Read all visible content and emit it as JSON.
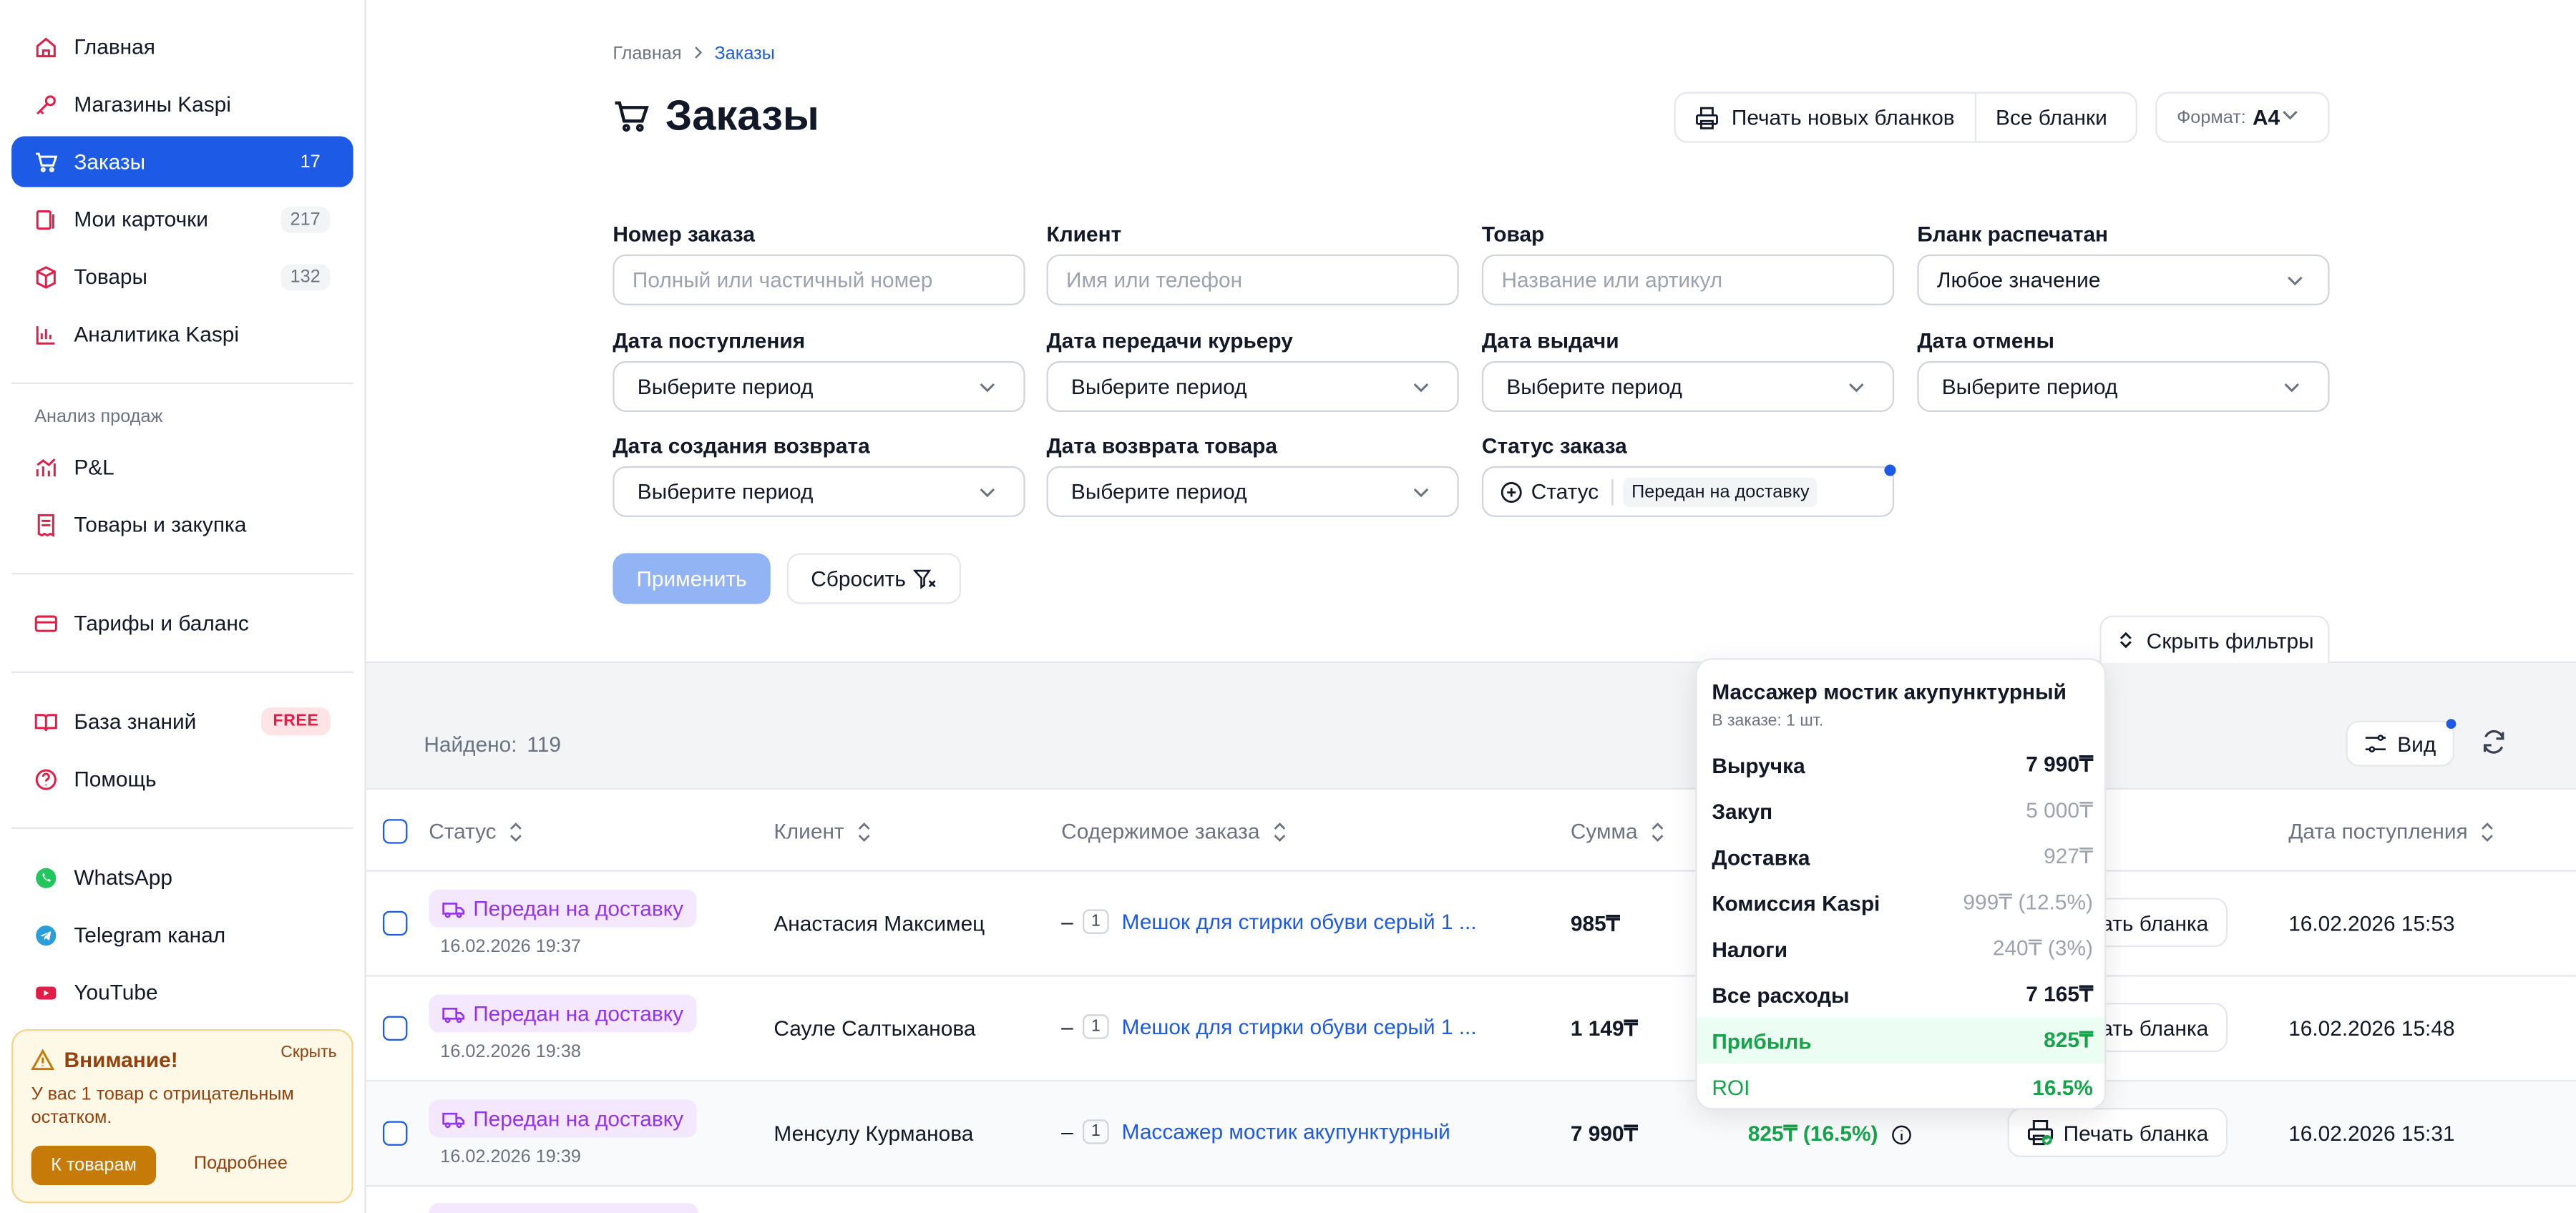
{
  "sidebar": {
    "items": [
      {
        "label": "Главная"
      },
      {
        "label": "Магазины Kaspi"
      },
      {
        "label": "Заказы",
        "count": "17"
      },
      {
        "label": "Мои карточки",
        "count": "217"
      },
      {
        "label": "Товары",
        "count": "132"
      },
      {
        "label": "Аналитика Kaspi"
      }
    ],
    "section_label": "Анализ продаж",
    "analysis_items": [
      {
        "label": "P&L"
      },
      {
        "label": "Товары и закупка"
      }
    ],
    "billing_label": "Тарифы и баланс",
    "knowledge_label": "База знаний",
    "knowledge_badge": "FREE",
    "help_label": "Помощь",
    "social": [
      {
        "label": "WhatsApp"
      },
      {
        "label": "Telegram канал"
      },
      {
        "label": "YouTube"
      }
    ],
    "warning": {
      "title": "Внимание!",
      "hide": "Скрыть",
      "text": "У вас 1 товар с отрицательным остатком.",
      "button": "К товарам",
      "more": "Подробнее"
    }
  },
  "breadcrumb": {
    "home": "Главная",
    "current": "Заказы"
  },
  "page_title": "Заказы",
  "toolbar": {
    "print_new": "Печать новых бланков",
    "all_forms": "Все бланки",
    "format_label": "Формат:",
    "format_value": "A4"
  },
  "filters": {
    "order_number": {
      "label": "Номер заказа",
      "placeholder": "Полный или частичный номер"
    },
    "client": {
      "label": "Клиент",
      "placeholder": "Имя или телефон"
    },
    "product": {
      "label": "Товар",
      "placeholder": "Название или артикул"
    },
    "form_printed": {
      "label": "Бланк распечатан",
      "value": "Любое значение"
    },
    "date_received": {
      "label": "Дата поступления",
      "value": "Выберите период"
    },
    "date_courier": {
      "label": "Дата передачи курьеру",
      "value": "Выберите период"
    },
    "date_issue": {
      "label": "Дата выдачи",
      "value": "Выберите период"
    },
    "date_cancel": {
      "label": "Дата отмены",
      "value": "Выберите период"
    },
    "date_return_created": {
      "label": "Дата создания возврата",
      "value": "Выберите период"
    },
    "date_return_product": {
      "label": "Дата возврата товара",
      "value": "Выберите период"
    },
    "order_status": {
      "label": "Статус заказа",
      "button": "Статус",
      "chip": "Передан на доставку"
    },
    "apply": "Применить",
    "reset": "Сбросить",
    "hide_filters": "Скрыть фильтры"
  },
  "results": {
    "found_label": "Найдено:",
    "found_count": "119",
    "view_label": "Вид"
  },
  "table": {
    "headers": {
      "status": "Статус",
      "client": "Клиент",
      "content": "Содержимое заказа",
      "sum": "Сумма",
      "date": "Дата поступления"
    },
    "rows": [
      {
        "status": "Передан на доставку",
        "status_date": "16.02.2026 19:37",
        "client": "Анастасия Максимец",
        "qty": "1",
        "product": "Мешок для стирки обуви серый 1 ...",
        "sum": "985₸",
        "print": "Печать бланка",
        "date": "16.02.2026 15:53"
      },
      {
        "status": "Передан на доставку",
        "status_date": "16.02.2026 19:38",
        "client": "Сауле Салтыханова",
        "qty": "1",
        "product": "Мешок для стирки обуви серый 1 ...",
        "sum": "1 149₸",
        "print": "Печать бланка",
        "date": "16.02.2026 15:48"
      },
      {
        "status": "Передан на доставку",
        "status_date": "16.02.2026 19:39",
        "client": "Менсулу Курманова",
        "qty": "1",
        "product": "Массажер мостик акупунктурный",
        "sum": "7 990₸",
        "profit": "825₸ (16.5%)",
        "print": "Печать бланка",
        "date": "16.02.2026 15:31"
      }
    ]
  },
  "tooltip": {
    "title": "Массажер мостик акупунктурный",
    "subtitle": "В заказе: 1 шт.",
    "rows": [
      {
        "label": "Выручка",
        "value": "7 990₸"
      },
      {
        "label": "Закуп",
        "value": "5 000₸"
      },
      {
        "label": "Доставка",
        "value": "927₸"
      },
      {
        "label": "Комиссия Kaspi",
        "value": "999₸ (12.5%)"
      },
      {
        "label": "Налоги",
        "value": "240₸ (3%)"
      },
      {
        "label": "Все расходы",
        "value": "7 165₸"
      },
      {
        "label": "Прибыль",
        "value": "825₸"
      },
      {
        "label": "ROI",
        "value": "16.5%"
      }
    ]
  },
  "colors": {
    "accent": "#1d5ae6",
    "status_purple": "#9333ea",
    "profit_green": "#16a34a",
    "warning_bg": "#fef9e7"
  }
}
